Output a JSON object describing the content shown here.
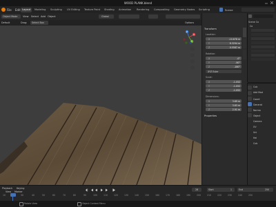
{
  "window": {
    "title": "WOOD PLANK.blend"
  },
  "menu": [
    "File",
    "Edit"
  ],
  "workspaces": [
    "Layout",
    "Modeling",
    "Sculpting",
    "UV Editing",
    "Texture Paint",
    "Shading",
    "Animation",
    "Rendering",
    "Compositing",
    "Geometry Nodes",
    "Scripting"
  ],
  "scene_label": "Scene",
  "viewport_header": {
    "mode": "Object Mode",
    "menus": [
      "View",
      "Select",
      "Add",
      "Object"
    ],
    "transform": "Global",
    "drag_label": "Drag:",
    "drag_value": "Select Box",
    "orientation_default": "Default",
    "options": "Options"
  },
  "npanel": {
    "transform_title": "Transform",
    "location_title": "Location:",
    "location": [
      {
        "axis": "X",
        "value": "-10.678 m"
      },
      {
        "axis": "Y",
        "value": "8.3294 m"
      },
      {
        "axis": "Z",
        "value": "0.5587 m"
      }
    ],
    "rotation_title": "Rotation:",
    "rotation": [
      {
        "axis": "X",
        "value": "-0°"
      },
      {
        "axis": "Y",
        "value": "-90°"
      },
      {
        "axis": "Z",
        "value": "-180°"
      }
    ],
    "rotation_mode": "XYZ Euler",
    "scale_title": "Scale:",
    "scale": [
      {
        "axis": "X",
        "value": "-1.052"
      },
      {
        "axis": "Y",
        "value": "-1.052"
      },
      {
        "axis": "Z",
        "value": "-1.052"
      }
    ],
    "dimensions_title": "Dimensions:",
    "dimensions": [
      {
        "axis": "X",
        "value": "3.69 m"
      },
      {
        "axis": "Y",
        "value": "3.63 m"
      },
      {
        "axis": "Z",
        "value": "2.91 m"
      }
    ],
    "properties_title": "Properties",
    "tabs": [
      "Item",
      "Tool",
      "View"
    ]
  },
  "outliner": {
    "header": "Scene Co",
    "items": [
      "Co",
      "",
      "",
      "",
      "",
      "",
      "",
      "",
      ""
    ]
  },
  "properties": {
    "labels": [
      "Cub",
      "Add Mod",
      "Coord",
      "Generat",
      "Norma",
      "Object",
      "Camera",
      "UV",
      "Uni",
      "Hei",
      "Cub"
    ]
  },
  "timeline": {
    "labels": [
      "Playback",
      "Keying",
      "View",
      "Marker"
    ],
    "frames": [
      "10",
      "20",
      "30",
      "40",
      "50",
      "60",
      "70",
      "80",
      "90",
      "100",
      "110",
      "120",
      "130",
      "140",
      "150",
      "160",
      "170",
      "180",
      "190",
      "200",
      "210",
      "220",
      "230",
      "240",
      "250"
    ],
    "current_frame": "28",
    "start_label": "Start",
    "start": "1",
    "end_label": "End",
    "end": "250"
  },
  "statusbar": {
    "items": [
      "Rotate View",
      "Object Context Menu"
    ]
  },
  "gizmo": {
    "x": "X",
    "y": "Y",
    "z": "Z"
  },
  "colors": {
    "accent": "#4772b3",
    "active_frame": "#4772b3",
    "x_axis": "#e0434f",
    "y_axis": "#6bb32e",
    "z_axis": "#3f7fe0"
  }
}
